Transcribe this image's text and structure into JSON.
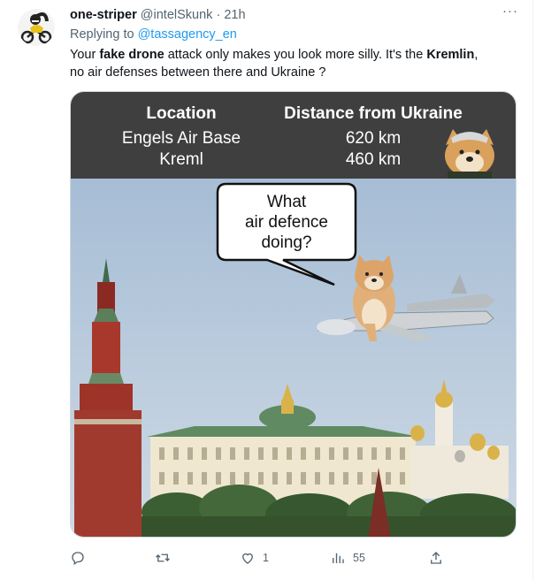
{
  "tweet": {
    "author_name": "one-striper",
    "author_handle": "@intelSkunk",
    "separator": "·",
    "time": "21h",
    "more_label": "···",
    "replying_prefix": "Replying to",
    "replying_to": "@tassagency_en",
    "text_parts": {
      "p1": "Your ",
      "b1": "fake drone",
      "p2": " attack only makes you look more silly. It's the ",
      "b2": "Kremlin",
      "p3": ",",
      "line2": "no air defenses between there and Ukraine ?"
    }
  },
  "meme": {
    "table": {
      "header_location": "Location",
      "header_distance": "Distance from Ukraine",
      "rows": [
        {
          "location": "Engels Air Base",
          "distance": "620 km"
        },
        {
          "location": "Kreml",
          "distance": "460 km"
        }
      ]
    },
    "bubble": {
      "line1": "What",
      "line2": "air defence",
      "line3": "doing?"
    },
    "colors": {
      "table_bg": "#404040",
      "sky_top": "#a9bfd6",
      "sky_bottom": "#cdd9e4"
    }
  },
  "actions": {
    "reply_icon": "reply-icon",
    "retweet_icon": "retweet-icon",
    "like_icon": "like-icon",
    "like_count": "1",
    "views_icon": "views-icon",
    "views_count": "55",
    "share_icon": "share-icon"
  },
  "colors": {
    "accent": "#1d9bf0",
    "secondary_text": "#536471"
  }
}
